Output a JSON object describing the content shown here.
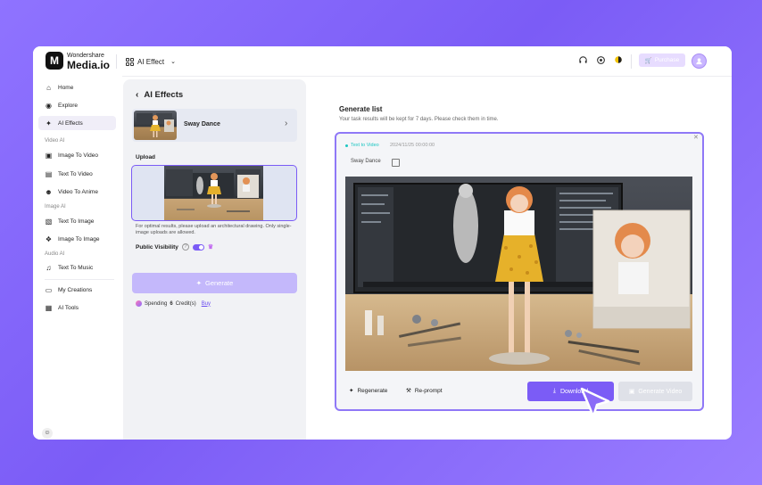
{
  "brand": {
    "top": "Wondershare",
    "main": "Media.io",
    "mark": "M"
  },
  "header": {
    "menu_label": "AI Effect",
    "purchase_label": "Purchase"
  },
  "sidebar": {
    "items": [
      {
        "label": "Home",
        "icon": "home-icon"
      },
      {
        "label": "Explore",
        "icon": "compass-icon"
      },
      {
        "label": "AI Effects",
        "icon": "sparkle-icon",
        "active": true
      },
      {
        "label": "Image To Video",
        "icon": "image-video-icon"
      },
      {
        "label": "Text To Video",
        "icon": "text-video-icon"
      },
      {
        "label": "Video To Anime",
        "icon": "anime-icon"
      },
      {
        "label": "Text To Image",
        "icon": "text-image-icon"
      },
      {
        "label": "Image To Image",
        "icon": "image-image-icon"
      },
      {
        "label": "Text To Music",
        "icon": "music-icon"
      },
      {
        "label": "My Creations",
        "icon": "folder-icon"
      },
      {
        "label": "AI Tools",
        "icon": "tools-icon"
      }
    ],
    "sections": [
      "Video AI",
      "Image AI",
      "Audio AI"
    ]
  },
  "panel": {
    "title": "AI Effects",
    "effect_name": "Sway Dance",
    "upload_label": "Upload",
    "hint": "For optimal results, please upload an architectural drawing. Only single-image uploads are allowed.",
    "visibility_label": "Public Visibility",
    "generate_label": "Generate",
    "spending_prefix": "Spending",
    "spending_amount": "6",
    "spending_suffix": "Credit(s)",
    "buy_label": "Buy"
  },
  "generate_list": {
    "title": "Generate list",
    "subtitle": "Your task results will be kept for 7 days. Please check them in time.",
    "item": {
      "tag": "Text to Video",
      "date": "2024/11/25  00:00:00",
      "name": "Sway Dance",
      "regenerate_label": "Regenerate",
      "reprompt_label": "Re-prompt",
      "download_label": "Download",
      "generate_video_label": "Generate Video"
    }
  },
  "colors": {
    "accent": "#7b5cf6",
    "teal": "#1cc6c2",
    "disabled": "#c4b8fb"
  }
}
